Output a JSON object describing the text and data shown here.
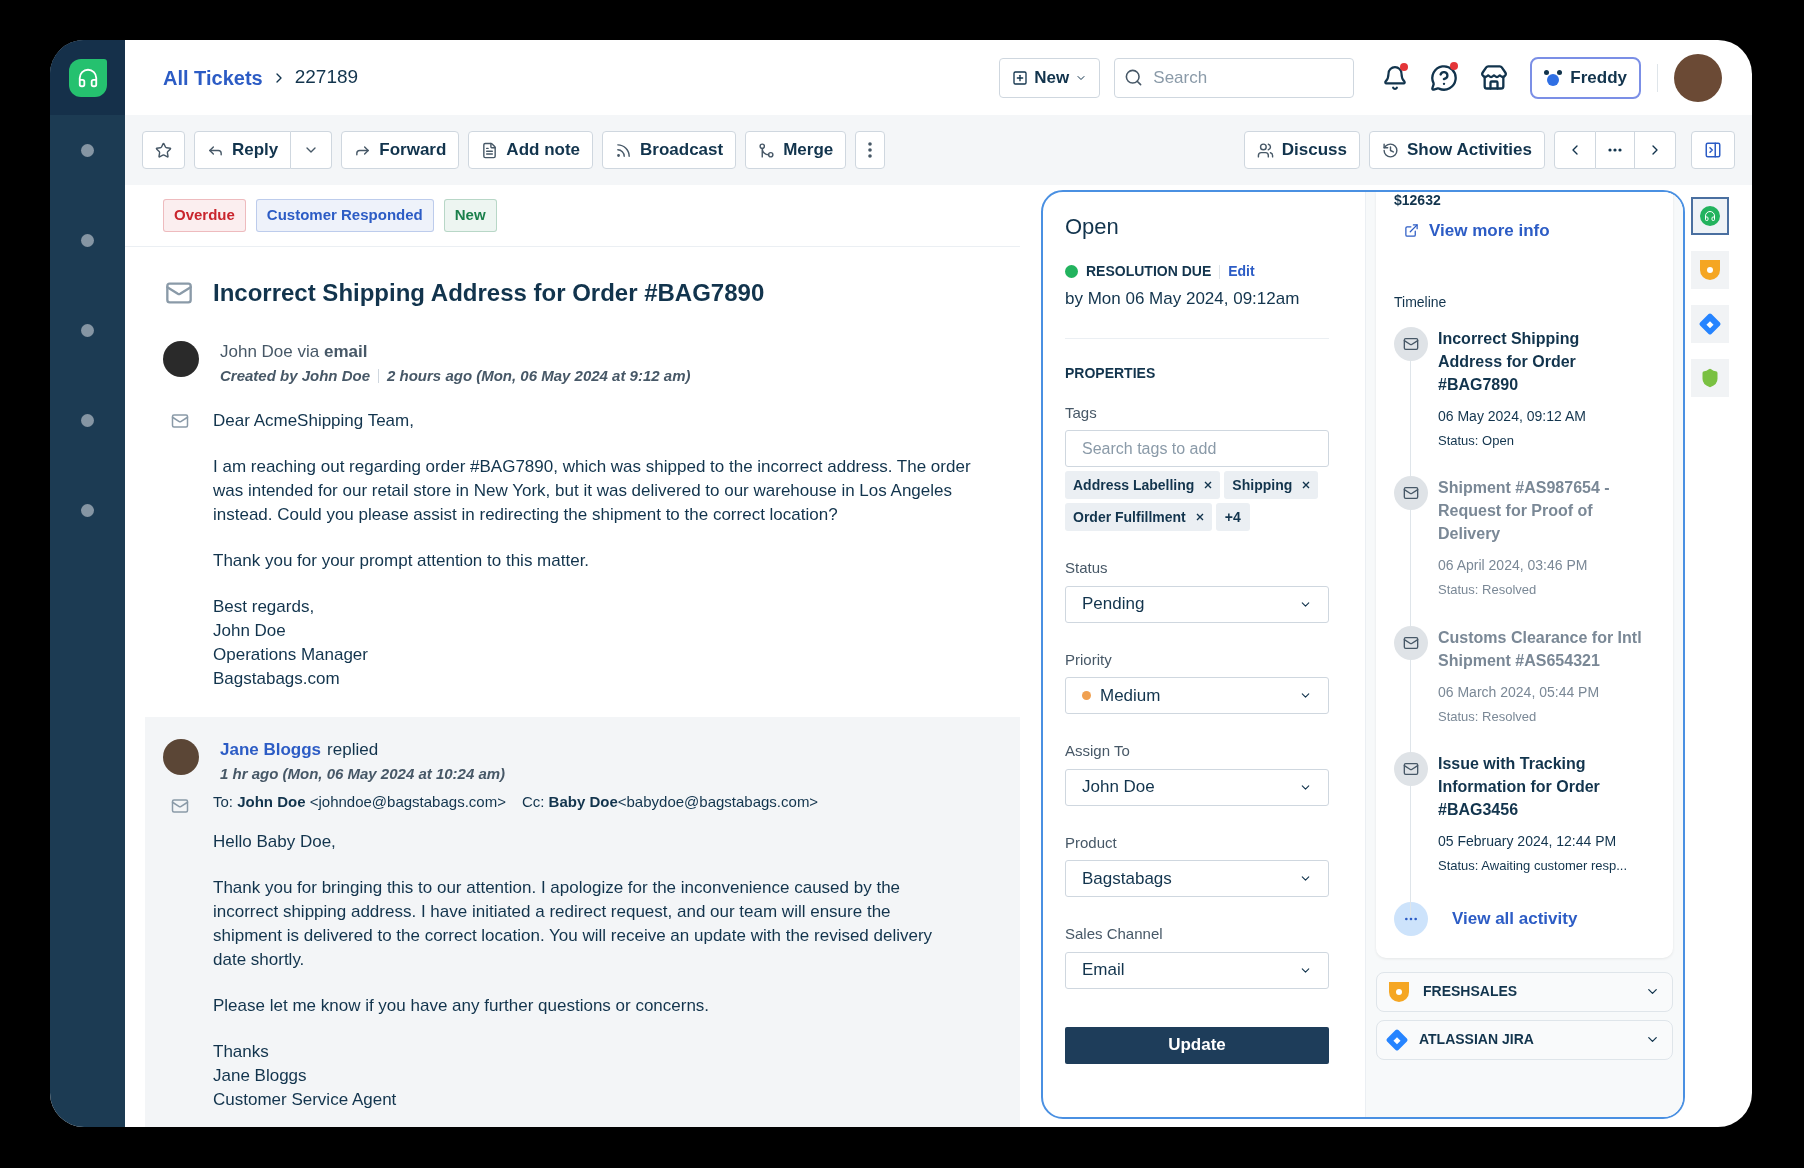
{
  "breadcrumb": {
    "link": "All Tickets",
    "current": "227189"
  },
  "header": {
    "new_button": "New",
    "search": {
      "placeholder": "Search"
    },
    "notifications": {
      "unread": true
    },
    "help": {
      "unread": true
    },
    "freddy": "Freddy"
  },
  "toolbar": {
    "left": [
      {
        "kind": "star"
      },
      {
        "kind": "reply",
        "label": "Reply"
      },
      {
        "kind": "forward",
        "label": "Forward"
      },
      {
        "kind": "note",
        "label": "Add note"
      },
      {
        "kind": "broadcast",
        "label": "Broadcast"
      },
      {
        "kind": "merge",
        "label": "Merge"
      },
      {
        "kind": "more"
      }
    ],
    "right": [
      {
        "kind": "discuss",
        "label": "Discuss"
      },
      {
        "kind": "activities",
        "label": "Show Activities"
      },
      {
        "kind": "pager"
      },
      {
        "kind": "panel"
      }
    ]
  },
  "status_tags": [
    {
      "label": "Overdue",
      "color": "#c9252d"
    },
    {
      "label": "Customer Responded",
      "color": "#2c5cc5"
    },
    {
      "label": "New",
      "color": "#1a7f4b"
    }
  ],
  "ticket": {
    "title": "Incorrect Shipping Address for Order #BAG7890",
    "messages": [
      {
        "kind": "incoming",
        "from": "John Doe via **email**",
        "created": "Created by John Doe",
        "time": "2 hours ago (Mon, 06 May 2024 at 9:12 am)",
        "paragraphs": [
          [
            "Dear AcmeShipping Team,"
          ],
          [
            "I am reaching out regarding order #BAG7890, which was shipped to the incorrect address. The order was intended for our retail store in New York, but it was delivered to our warehouse in Los Angeles instead. Could you please assist in redirecting the shipment to the correct location?"
          ],
          [
            "Thank you for your prompt attention to this matter."
          ],
          [
            "Best regards,",
            "John Doe",
            "Operations Manager",
            "Bagstabags.com"
          ]
        ]
      },
      {
        "kind": "reply",
        "author": "Jane Bloggs",
        "action": "replied",
        "time": "1 hr ago (Mon, 06 May 2024 at 10:24 am)",
        "to": "To: **John Doe** <johndoe@bagstabags.com>",
        "cc": "Cc: **Baby Doe**<babydoe@bagstabags.com>",
        "paragraphs": [
          [
            "Hello Baby Doe,"
          ],
          [
            "Thank you for bringing this to our attention. I apologize for the inconvenience caused by the incorrect shipping address. I have initiated a redirect request, and our team will ensure the shipment is delivered to the correct location. You will receive an update with the revised delivery date shortly."
          ],
          [
            "Please let me know if you have any further questions or concerns."
          ],
          [
            "Thanks",
            "Jane Bloggs",
            "Customer Service Agent"
          ]
        ]
      }
    ]
  },
  "details": {
    "status": "Open",
    "resolution": {
      "label": "RESOLUTION DUE",
      "edit": "Edit",
      "due": "by Mon 06 May 2024, 09:12am",
      "color": "#22b35e"
    },
    "properties_title": "PROPERTIES",
    "tags": {
      "label": "Tags",
      "placeholder": "Search tags to add",
      "items": [
        "Address Labelling",
        "Shipping",
        "Order Fulfillment"
      ],
      "more": "+4"
    },
    "fields": [
      {
        "label": "Status",
        "value": "Pending"
      },
      {
        "label": "Priority",
        "value": "Medium",
        "color": "#f0a050"
      },
      {
        "label": "Assign To",
        "value": "John Doe"
      },
      {
        "label": "Product",
        "value": "Bagstabags"
      },
      {
        "label": "Sales Channel",
        "value": "Email"
      }
    ],
    "update_button": "Update"
  },
  "contact": {
    "amount": "$12632",
    "view_more": "View more info",
    "timeline_title": "Timeline",
    "timeline": [
      {
        "title": "Incorrect Shipping Address for Order #BAG7890",
        "date": "06 May 2024, 09:12 AM",
        "status": "Status: Open",
        "faded": false
      },
      {
        "title": "Shipment #AS987654 - Request for Proof of Delivery",
        "date": "06 April 2024, 03:46 PM",
        "status": "Status: Resolved",
        "faded": true
      },
      {
        "title": "Customs Clearance for Intl Shipment #AS654321",
        "date": "06 March 2024, 05:44 PM",
        "status": "Status: Resolved",
        "faded": true
      },
      {
        "title": "Issue with Tracking Information for Order #BAG3456",
        "date": "05 February 2024, 12:44 PM",
        "status": "Status: Awaiting customer resp...",
        "faded": false
      }
    ],
    "view_all": "View all activity"
  },
  "integrations": [
    {
      "kind": "freshsales",
      "label": "FRESHSALES"
    },
    {
      "kind": "jira",
      "label": "ATLASSIAN JIRA"
    }
  ],
  "side_apps": [
    {
      "kind": "desk",
      "selected": true
    },
    {
      "kind": "sales",
      "selected": false
    },
    {
      "kind": "jira",
      "selected": false
    },
    {
      "kind": "shield",
      "selected": false
    }
  ]
}
